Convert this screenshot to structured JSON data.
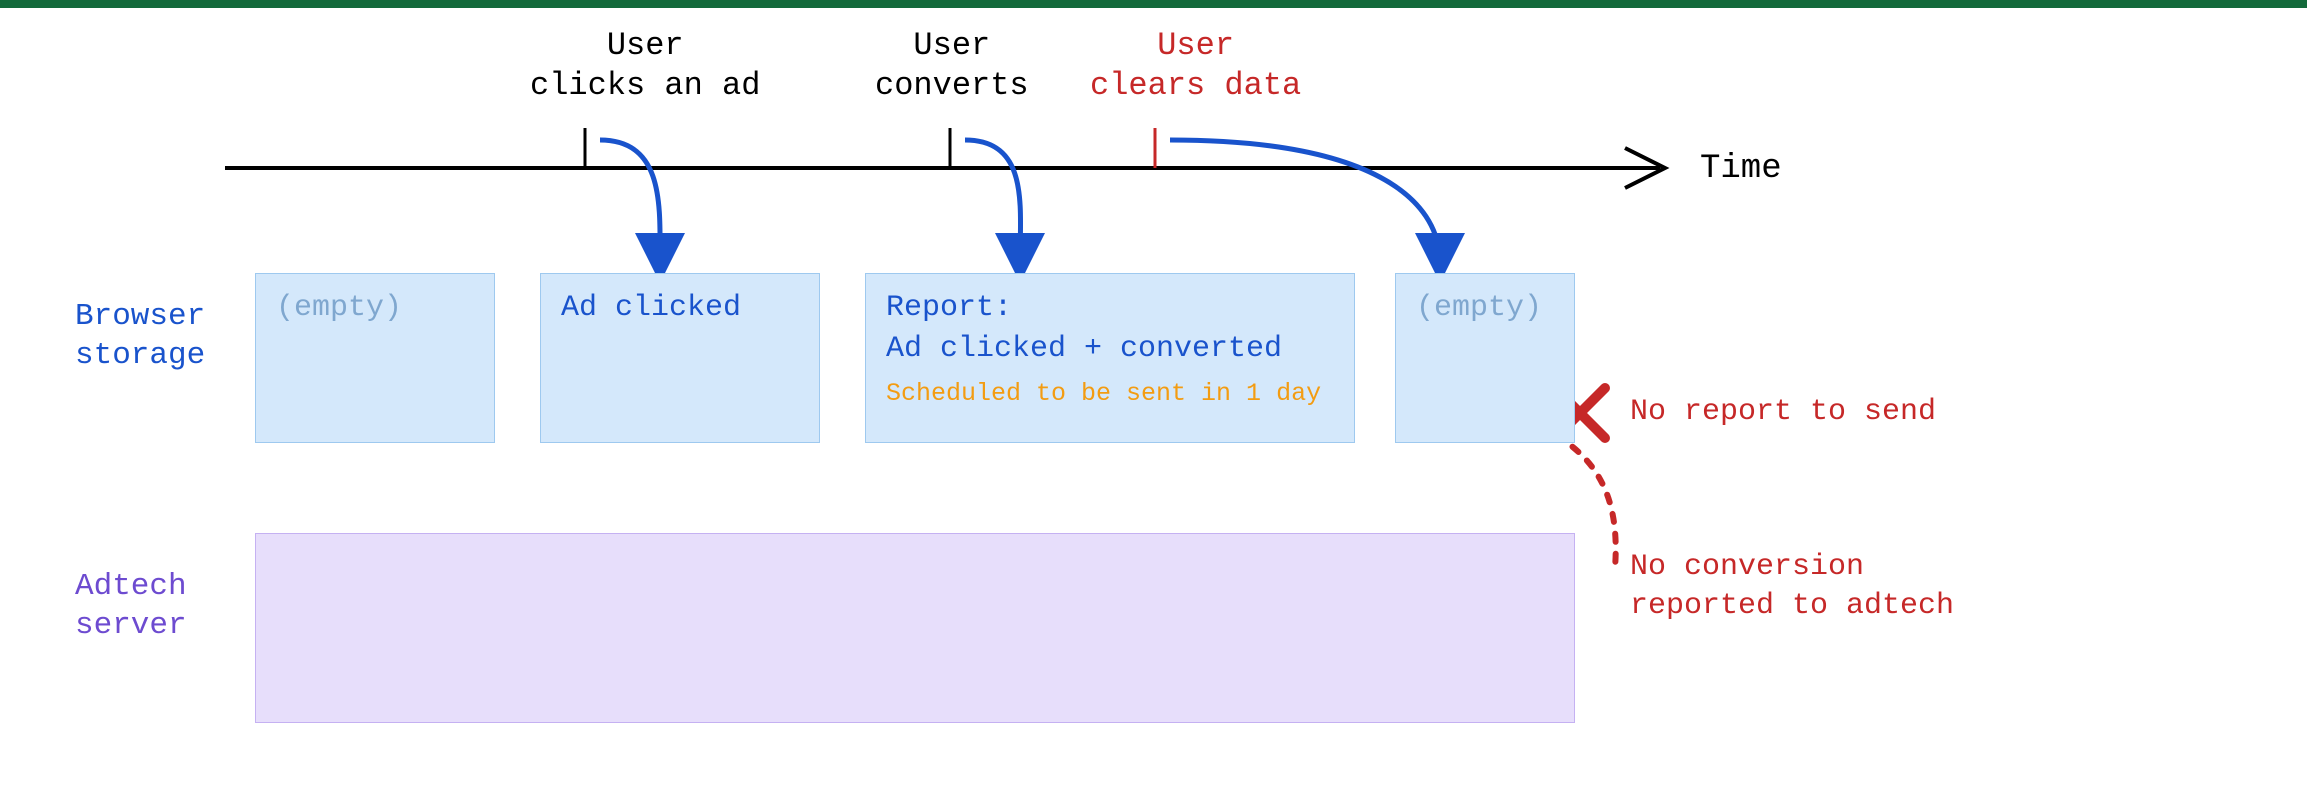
{
  "timeline": {
    "axis_label": "Time",
    "events": [
      {
        "label": "User\nclicks an ad",
        "color": "black"
      },
      {
        "label": "User\nconverts",
        "color": "black"
      },
      {
        "label": "User\nclears data",
        "color": "red"
      }
    ]
  },
  "rows": {
    "browser_storage_label": "Browser\nstorage",
    "adtech_server_label": "Adtech\nserver"
  },
  "storage_boxes": {
    "empty1": "(empty)",
    "ad_clicked": "Ad clicked",
    "report_title": "Report:\nAd clicked + converted",
    "report_sched": "Scheduled to be sent in 1 day",
    "empty2": "(empty)"
  },
  "annotations": {
    "no_report": "No report to send",
    "no_conversion": "No conversion\nreported to adtech"
  },
  "colors": {
    "blue": "#1953cc",
    "red": "#c62828",
    "purple": "#6d4bd0",
    "orange": "#f39c12",
    "storage_bg": "#d4e8fb",
    "adtech_bg": "#e7defb"
  }
}
